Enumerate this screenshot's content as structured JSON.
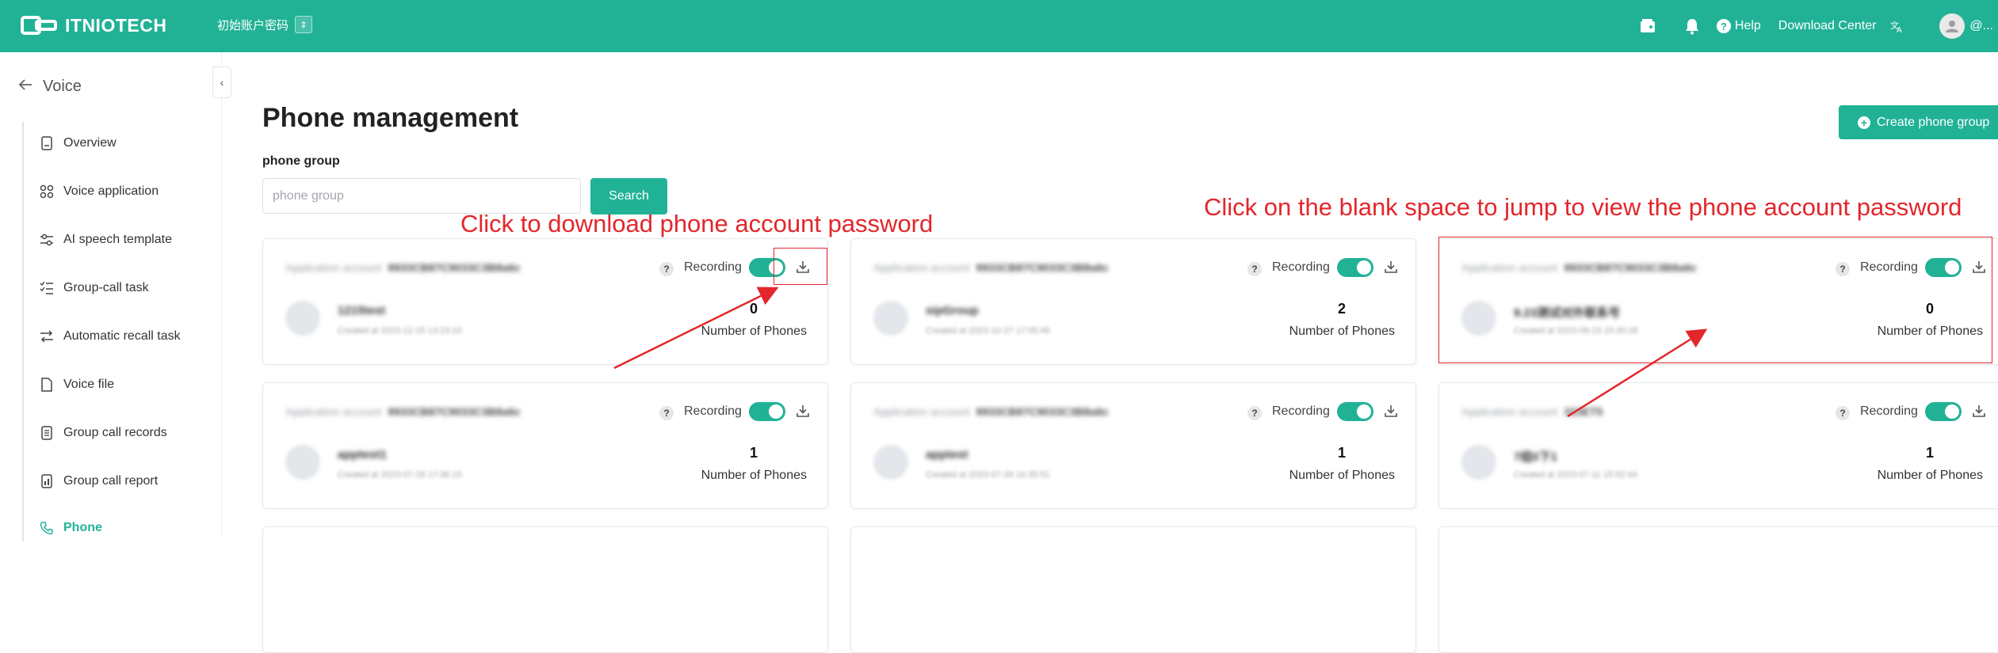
{
  "header": {
    "brand": "ITNIOTECH",
    "account_switch_label": "初始账户密码",
    "help_label": "Help",
    "download_center_label": "Download Center",
    "user_label": "@..."
  },
  "sidebar": {
    "back_label": "Voice",
    "items": [
      {
        "label": "Overview",
        "icon": "document-icon"
      },
      {
        "label": "Voice application",
        "icon": "apps-icon"
      },
      {
        "label": "AI speech template",
        "icon": "sliders-icon"
      },
      {
        "label": "Group-call task",
        "icon": "checklist-icon"
      },
      {
        "label": "Automatic recall task",
        "icon": "recall-icon"
      },
      {
        "label": "Voice file",
        "icon": "file-icon"
      },
      {
        "label": "Group call records",
        "icon": "records-icon"
      },
      {
        "label": "Group call report",
        "icon": "report-icon"
      },
      {
        "label": "Phone",
        "icon": "phone-icon",
        "active": true
      }
    ]
  },
  "main": {
    "title": "Phone management",
    "create_button": "Create phone group",
    "filter_label": "phone group",
    "search_placeholder": "phone group",
    "search_button": "Search"
  },
  "cards": [
    {
      "app_account_label": "Application account",
      "app_account_value": "9933CB87C9033C3B8a6c",
      "group_name": "1215test",
      "created": "Created at 2023-12-15 13:23:10",
      "count": "0",
      "count_label": "Number of Phones",
      "recording_label": "Recording"
    },
    {
      "app_account_label": "Application account",
      "app_account_value": "9933CB87C9033C3B8a6c",
      "group_name": "sipGroup",
      "created": "Created at 2023-10-27 17:05:49",
      "count": "2",
      "count_label": "Number of Phones",
      "recording_label": "Recording"
    },
    {
      "app_account_label": "Application account",
      "app_account_value": "9933CB87C9033C3B8a6c",
      "group_name": "9.23测试对外联系号",
      "created": "Created at 2023-09-23 15:30:28",
      "count": "0",
      "count_label": "Number of Phones",
      "recording_label": "Recording"
    },
    {
      "app_account_label": "Application account",
      "app_account_value": "9933CB87C9033C3B8a6c",
      "group_name": "apptest1",
      "created": "Created at 2023-07-28 17:36:15",
      "count": "1",
      "count_label": "Number of Phones",
      "recording_label": "Recording"
    },
    {
      "app_account_label": "Application account",
      "app_account_value": "9933CB87C9033C3B8a6c",
      "group_name": "apptest",
      "created": "Created at 2023-07-28 16:35:51",
      "count": "1",
      "count_label": "Number of Phones",
      "recording_label": "Recording"
    },
    {
      "app_account_label": "Application account",
      "app_account_value": "323ET5",
      "group_name": "7组0下1",
      "created": "Created at 2023-07-11 15:52:44",
      "count": "1",
      "count_label": "Number of Phones",
      "recording_label": "Recording"
    }
  ],
  "annotations": {
    "download_hint": "Click to download phone account password",
    "view_hint": "Click on the blank space to jump to view the phone account password"
  },
  "colors": {
    "brand": "#21b296",
    "annotation": "#e3262b"
  }
}
